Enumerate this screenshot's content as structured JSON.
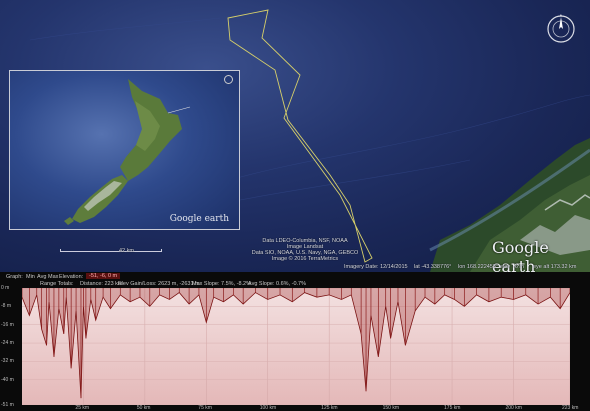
{
  "map": {
    "inset_watermark": "Google earth",
    "scale_label": "42 km",
    "attribution": [
      "Data LDEO-Columbia, NSF, NOAA",
      "Image Landsat",
      "Data SIO, NOAA, U.S. Navy, NGA, GEBCO",
      "Image © 2016 TerraMetrics"
    ],
    "watermark": "Google earth",
    "status": {
      "imagery_date": "Imagery Date: 12/14/2015",
      "lat": "lat  -43.338776°",
      "lon": "lon  168.222458°",
      "elev": "elev",
      "elev_value": "-6 m",
      "eye_alt": "eye alt 173.32 km"
    }
  },
  "elevation_profile": {
    "toolbar_row1": {
      "graph": "Graph:",
      "min": "Min",
      "avg": "Avg",
      "max": "Max",
      "elevation": "Elevation:",
      "elev_values": "-51, -6, 0 m"
    },
    "toolbar_row2": {
      "range_totals": "Range Totals:",
      "distance": "Distance: 223 km",
      "elev_gain_loss": "Elev Gain/Loss: 2623 m, -2631 m",
      "max_slope": "Max Slope: 7.5%, -8.2%",
      "avg_slope": "Avg Slope: 0.6%, -0.7%"
    },
    "y_labels": [
      "0 m",
      "-8 m",
      "-16 m",
      "-24 m",
      "-32 m",
      "-40 m",
      "-51 m"
    ],
    "x_labels": [
      "25 km",
      "50 km",
      "75 km",
      "100 km",
      "125 km",
      "150 km",
      "175 km",
      "200 km",
      "223 km"
    ]
  },
  "chart_data": {
    "type": "area",
    "title": "",
    "xlabel": "",
    "ylabel": "",
    "xlim": [
      0,
      223
    ],
    "ylim": [
      -51,
      0
    ],
    "x_ticks": [
      "25 km",
      "50 km",
      "75 km",
      "100 km",
      "125 km",
      "150 km",
      "175 km",
      "200 km",
      "223 km"
    ],
    "y_ticks": [
      "0 m",
      "-8 m",
      "-16 m",
      "-24 m",
      "-32 m",
      "-40 m",
      "-51 m"
    ],
    "series": [
      {
        "x": [
          0,
          3,
          6,
          8,
          10,
          11,
          13,
          15,
          17,
          18,
          20,
          22,
          24,
          25,
          26,
          28,
          30,
          33,
          36,
          40,
          44,
          48,
          52,
          56,
          60,
          64,
          68,
          72,
          75,
          78,
          82,
          86,
          90,
          95,
          100,
          105,
          110,
          115,
          120,
          125,
          130,
          134,
          138,
          140,
          142,
          145,
          148,
          150,
          153,
          156,
          160,
          164,
          168,
          172,
          176,
          180,
          185,
          190,
          195,
          200,
          205,
          210,
          215,
          219,
          223
        ],
        "y": [
          -4,
          -12,
          -3,
          -18,
          -25,
          -6,
          -30,
          -9,
          -20,
          -4,
          -35,
          -10,
          -48,
          -8,
          -22,
          -5,
          -14,
          -4,
          -9,
          -3,
          -6,
          -4,
          -8,
          -3,
          -5,
          -2,
          -7,
          -3,
          -15,
          -4,
          -6,
          -3,
          -7,
          -2,
          -5,
          -3,
          -6,
          -2,
          -4,
          -3,
          -5,
          -3,
          -20,
          -45,
          -12,
          -30,
          -8,
          -22,
          -6,
          -25,
          -10,
          -4,
          -7,
          -3,
          -5,
          -8,
          -3,
          -6,
          -4,
          -5,
          -3,
          -7,
          -4,
          -9,
          -2
        ]
      }
    ]
  }
}
